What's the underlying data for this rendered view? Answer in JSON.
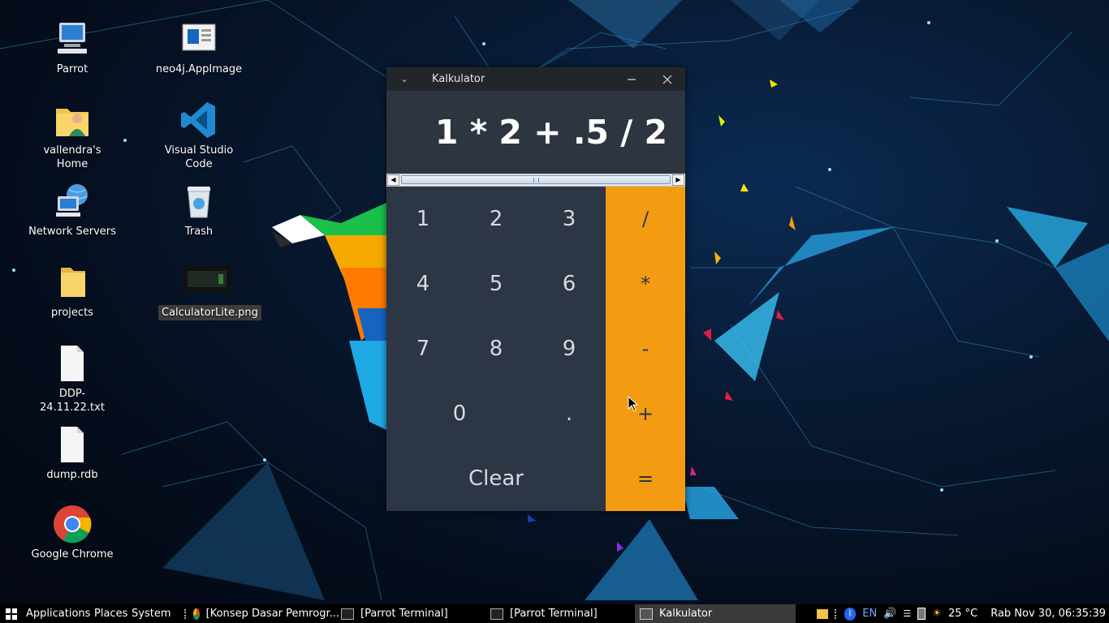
{
  "desktop": {
    "icons": [
      {
        "label": "Parrot"
      },
      {
        "label": "vallendra's Home"
      },
      {
        "label": "Network Servers"
      },
      {
        "label": "projects"
      },
      {
        "label": "DDP-24.11.22.txt"
      },
      {
        "label": "dump.rdb"
      },
      {
        "label": "Google Chrome"
      },
      {
        "label": "neo4j.AppImage"
      },
      {
        "label": "Visual Studio Code"
      },
      {
        "label": "Trash"
      },
      {
        "label": "CalculatorLite.png"
      }
    ]
  },
  "calculator": {
    "title": "Kalkulator",
    "display": "1 * 2 + .5 / 2",
    "keys": {
      "k1": "1",
      "k2": "2",
      "k3": "3",
      "k4": "4",
      "k5": "5",
      "k6": "6",
      "k7": "7",
      "k8": "8",
      "k9": "9",
      "k0": "0",
      "kdot": ".",
      "clear": "Clear"
    },
    "ops": {
      "divide": "/",
      "multiply": "*",
      "minus": "-",
      "plus": "+",
      "equals": "="
    },
    "colors": {
      "keypad": "#2c3645",
      "operators": "#f39c12",
      "titlebar": "#22262b"
    }
  },
  "taskbar": {
    "applications": "Applications",
    "places": "Places",
    "system": "System",
    "tasks": [
      {
        "label": "[Konsep Dasar Pemrogr..."
      },
      {
        "label": "[Parrot Terminal]"
      },
      {
        "label": "[Parrot Terminal]"
      },
      {
        "label": "Kalkulator"
      }
    ],
    "keyboard_layout": "EN",
    "temperature": "25 °C",
    "datetime": "Rab Nov 30, 06:35:39"
  }
}
